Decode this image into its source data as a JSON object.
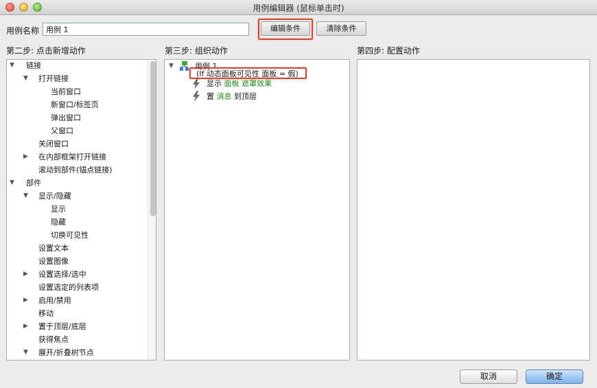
{
  "window": {
    "title": "用例编辑器 (鼠标单击时)"
  },
  "case_name": {
    "label": "用例名称",
    "value": "用例 1"
  },
  "buttons": {
    "edit_condition": "编辑条件",
    "clear_condition": "清除条件",
    "cancel": "取消",
    "ok": "确定"
  },
  "steps": {
    "step2": "第二步: 点击新增动作",
    "step3": "第三步: 组织动作",
    "step4": "第四步: 配置动作"
  },
  "actions_tree": [
    "链接",
    "打开链接",
    "当前窗口",
    "新窗口/标签页",
    "弹出窗口",
    "父窗口",
    "关闭窗口",
    "在内部框架打开链接",
    "滚动到部件(锚点链接)",
    "部件",
    "显示/隐藏",
    "显示",
    "隐藏",
    "切换可见性",
    "设置文本",
    "设置图像",
    "设置选择/选中",
    "设置选定的列表项",
    "启用/禁用",
    "移动",
    "置于顶层/底层",
    "获得焦点",
    "展开/折叠树节点"
  ],
  "organize": {
    "case_label": "用例 1",
    "condition": "(If 动态面板可见性 面板 = 假)",
    "action1": {
      "verb": "显示",
      "target": "面板",
      "effect": "遮罩效果"
    },
    "action2": {
      "verb": "置",
      "target": "消息",
      "suffix": "到顶层"
    }
  },
  "colors": {
    "highlight": "#d8412f",
    "green_text": "#1f8a1f"
  }
}
